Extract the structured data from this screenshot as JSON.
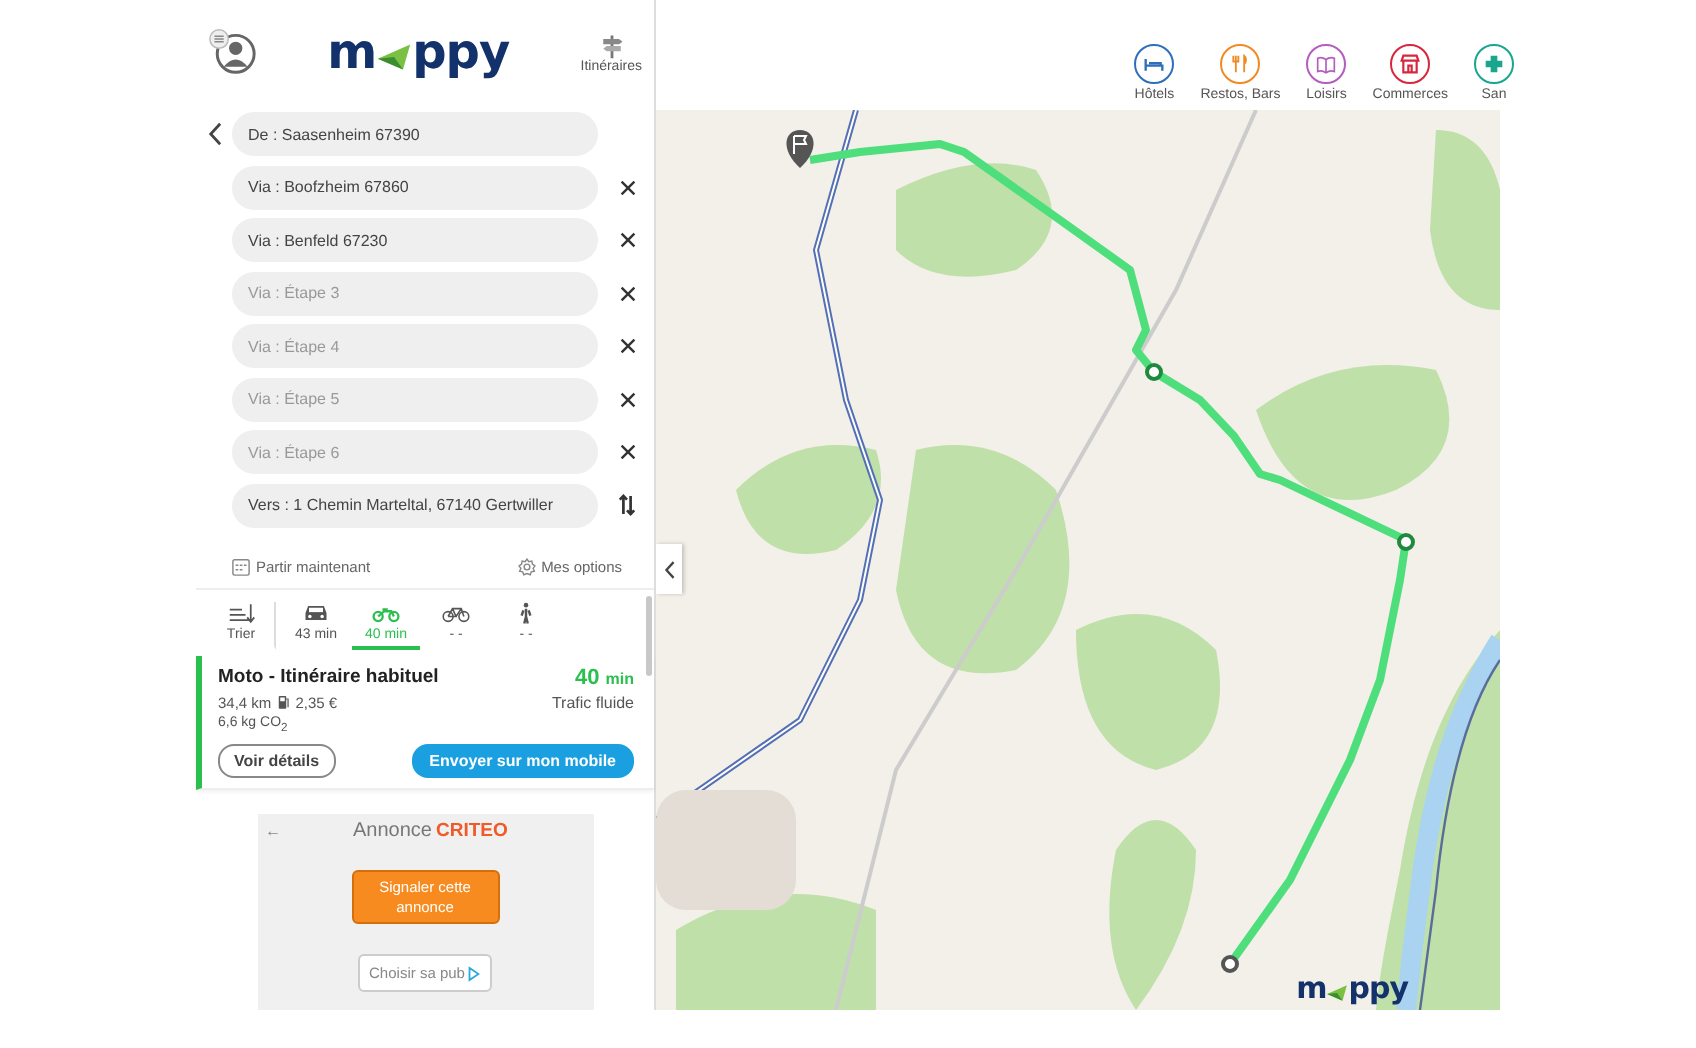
{
  "header": {
    "logo": {
      "before": "m",
      "after": "ppy"
    },
    "itineraries_label": "Itinéraires"
  },
  "route_fields": [
    {
      "kind": "from",
      "value": "De : Saasenheim 67390"
    },
    {
      "kind": "via",
      "value": "Via : Boofzheim 67860"
    },
    {
      "kind": "via",
      "value": "Via : Benfeld 67230"
    },
    {
      "kind": "via",
      "placeholder": "Via : Étape 3"
    },
    {
      "kind": "via",
      "placeholder": "Via : Étape 4"
    },
    {
      "kind": "via",
      "placeholder": "Via : Étape 5"
    },
    {
      "kind": "via",
      "placeholder": "Via : Étape 6"
    },
    {
      "kind": "to",
      "value": "Vers : 1 Chemin Marteltal, 67140 Gertwiller"
    }
  ],
  "departure": "Partir maintenant",
  "options": "Mes options",
  "modes": [
    {
      "kind": "sort",
      "label": "Trier",
      "selected": false
    },
    {
      "kind": "car",
      "label": "43 min",
      "selected": false
    },
    {
      "kind": "moto",
      "label": "40 min",
      "selected": true
    },
    {
      "kind": "bike",
      "label": "- -",
      "selected": false
    },
    {
      "kind": "walk",
      "label": "- -",
      "selected": false
    }
  ],
  "result": {
    "title": "Moto - Itinéraire habituel",
    "duration_value": "40",
    "duration_unit": "min",
    "distance": "34,4 km",
    "cost": "2,35 €",
    "traffic": "Trafic fluide",
    "emissions": "6,6 kg CO$_{2}$",
    "details_button": "Voir détails",
    "send_button": "Envoyer sur mon mobile"
  },
  "ad": {
    "back": "←",
    "label": "Annonce",
    "brand": "CRITEO",
    "report_button": "Signaler cette annonce",
    "choose_link": "Choisir sa pub"
  },
  "categories": [
    {
      "kind": "hotel",
      "label": "Hôtels",
      "color": "#2d6fb8"
    },
    {
      "kind": "food",
      "label": "Restos, Bars",
      "color": "#f08a24"
    },
    {
      "kind": "leisure",
      "label": "Loisirs",
      "color": "#b45cc0"
    },
    {
      "kind": "shop",
      "label": "Commerces",
      "color": "#d7263d"
    },
    {
      "kind": "health",
      "label": "San",
      "color": "#1aa58f"
    }
  ],
  "map": {
    "logo": {
      "before": "m",
      "after": "ppy"
    }
  }
}
